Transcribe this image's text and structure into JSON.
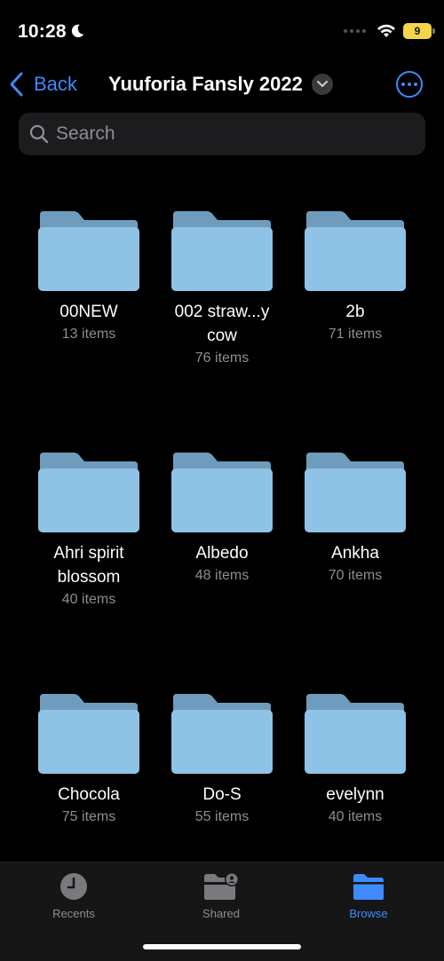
{
  "status": {
    "time": "10:28",
    "battery": "9"
  },
  "nav": {
    "back_label": "Back",
    "title": "Yuuforia Fansly 2022"
  },
  "search": {
    "placeholder": "Search"
  },
  "folders": [
    {
      "name": "00NEW",
      "count": "13 items"
    },
    {
      "name": "002 straw...y cow",
      "count": "76 items"
    },
    {
      "name": "2b",
      "count": "71 items"
    },
    {
      "name": "Ahri spirit blossom",
      "count": "40 items"
    },
    {
      "name": "Albedo",
      "count": "48 items"
    },
    {
      "name": "Ankha",
      "count": "70 items"
    },
    {
      "name": "Chocola",
      "count": "75 items"
    },
    {
      "name": "Do-S",
      "count": "55 items"
    },
    {
      "name": "evelynn",
      "count": "40 items"
    }
  ],
  "tabs": [
    {
      "label": "Recents",
      "icon": "clock-icon"
    },
    {
      "label": "Shared",
      "icon": "shared-folder-icon"
    },
    {
      "label": "Browse",
      "icon": "folder-icon",
      "active": true
    }
  ],
  "colors": {
    "accent": "#3d8bfd",
    "folder": "#8ec3e6",
    "battery": "#f5d64a"
  }
}
